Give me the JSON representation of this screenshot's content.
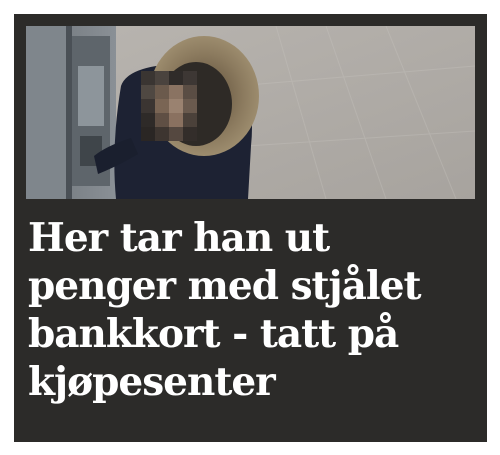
{
  "article": {
    "headline": "Her tar han ut penger med stjålet bankkort - tatt på kjøpesenter"
  },
  "photo": {
    "content": "surveillance-still-atm"
  },
  "colors": {
    "card_background": "#2c2b29",
    "headline_text": "#ffffff",
    "page_background": "#ffffff"
  }
}
